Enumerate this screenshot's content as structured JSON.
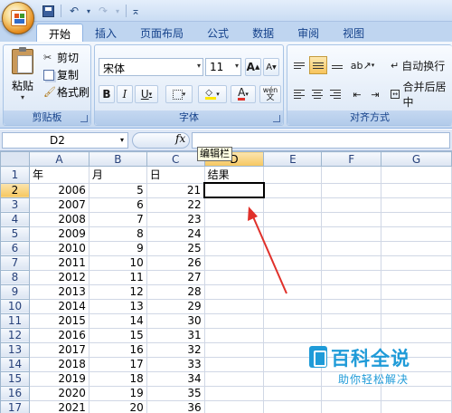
{
  "qat": {
    "dropdown_glyph": "▾"
  },
  "tabs": [
    "开始",
    "插入",
    "页面布局",
    "公式",
    "数据",
    "审阅",
    "视图"
  ],
  "clipboard": {
    "paste_label": "粘贴",
    "cut_label": "剪切",
    "copy_label": "复制",
    "format_painter_label": "格式刷",
    "group_label": "剪贴板"
  },
  "font": {
    "name": "宋体",
    "size": "11",
    "bold": "B",
    "italic": "I",
    "underline": "U",
    "grow": "A",
    "shrink": "A",
    "color_letter": "A",
    "phonetic": "wén",
    "group_label": "字体"
  },
  "alignment": {
    "wrap_label": "自动换行",
    "merge_label": "合并后居中",
    "group_label": "对齐方式"
  },
  "formula_bar": {
    "name_box": "D2",
    "fx": "fx",
    "value": ""
  },
  "tooltip": "编辑栏",
  "columns": [
    "A",
    "B",
    "C",
    "D",
    "E",
    "F",
    "G"
  ],
  "selected_column": "D",
  "selected_row": "2",
  "rows": [
    {
      "n": "1",
      "a": "年",
      "b": "月",
      "c": "日",
      "d": "结果"
    },
    {
      "n": "2",
      "a": "2006",
      "b": "5",
      "c": "21",
      "d": ""
    },
    {
      "n": "3",
      "a": "2007",
      "b": "6",
      "c": "22",
      "d": ""
    },
    {
      "n": "4",
      "a": "2008",
      "b": "7",
      "c": "23",
      "d": ""
    },
    {
      "n": "5",
      "a": "2009",
      "b": "8",
      "c": "24",
      "d": ""
    },
    {
      "n": "6",
      "a": "2010",
      "b": "9",
      "c": "25",
      "d": ""
    },
    {
      "n": "7",
      "a": "2011",
      "b": "10",
      "c": "26",
      "d": ""
    },
    {
      "n": "8",
      "a": "2012",
      "b": "11",
      "c": "27",
      "d": ""
    },
    {
      "n": "9",
      "a": "2013",
      "b": "12",
      "c": "28",
      "d": ""
    },
    {
      "n": "10",
      "a": "2014",
      "b": "13",
      "c": "29",
      "d": ""
    },
    {
      "n": "11",
      "a": "2015",
      "b": "14",
      "c": "30",
      "d": ""
    },
    {
      "n": "12",
      "a": "2016",
      "b": "15",
      "c": "31",
      "d": ""
    },
    {
      "n": "13",
      "a": "2017",
      "b": "16",
      "c": "32",
      "d": ""
    },
    {
      "n": "14",
      "a": "2018",
      "b": "17",
      "c": "33",
      "d": ""
    },
    {
      "n": "15",
      "a": "2019",
      "b": "18",
      "c": "34",
      "d": ""
    },
    {
      "n": "16",
      "a": "2020",
      "b": "19",
      "c": "35",
      "d": ""
    },
    {
      "n": "17",
      "a": "2021",
      "b": "20",
      "c": "36",
      "d": ""
    }
  ],
  "watermark": {
    "title": "百科全说",
    "subtitle": "助你轻松解决"
  },
  "colors": {
    "accent": "#15428b",
    "arrow": "#e0302a",
    "watermark": "#1f9bd8"
  }
}
